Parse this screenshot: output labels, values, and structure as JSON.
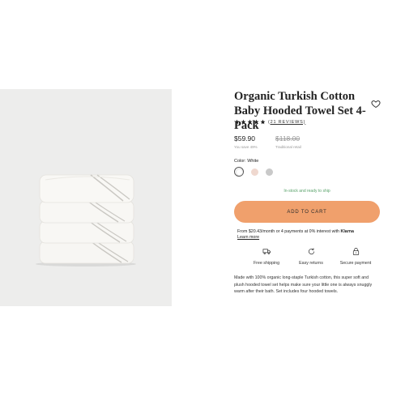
{
  "product": {
    "title": "Organic Turkish Cotton Baby Hooded Towel Set 4-Pack",
    "rating_stars": 5,
    "reviews_label": "(21 REVIEWS)",
    "price": "$59.90",
    "price_note": "You save 49%",
    "original_price": "$118.00",
    "original_note": "Traditional retail",
    "color_label": "Color: White",
    "colors": [
      {
        "name": "White",
        "hex": "#ffffff",
        "selected": true
      },
      {
        "name": "Blush",
        "hex": "#efd8cf",
        "selected": false
      },
      {
        "name": "Grey",
        "hex": "#c9c9c9",
        "selected": false
      }
    ],
    "stock_status": "In-stock and ready to ship",
    "add_to_cart_label": "ADD TO CART",
    "klarna_text": "From $20.43/month or 4 payments at 0% interest with",
    "klarna_brand": "Klarna",
    "learn_more_label": "Learn more",
    "features": [
      {
        "icon": "truck-icon",
        "label": "Free shipping"
      },
      {
        "icon": "returns-icon",
        "label": "Easy returns"
      },
      {
        "icon": "lock-icon",
        "label": "Secure payment"
      }
    ],
    "description": "Made with 100% organic long-staple Turkish cotton, this super soft and plush hooded towel set helps make sure your little one is always snuggly warm after their bath. Set includes four hooded towels."
  },
  "colors": {
    "accent": "#f0a06c",
    "stock_green": "#5aa36b",
    "image_bg": "#ededec"
  }
}
